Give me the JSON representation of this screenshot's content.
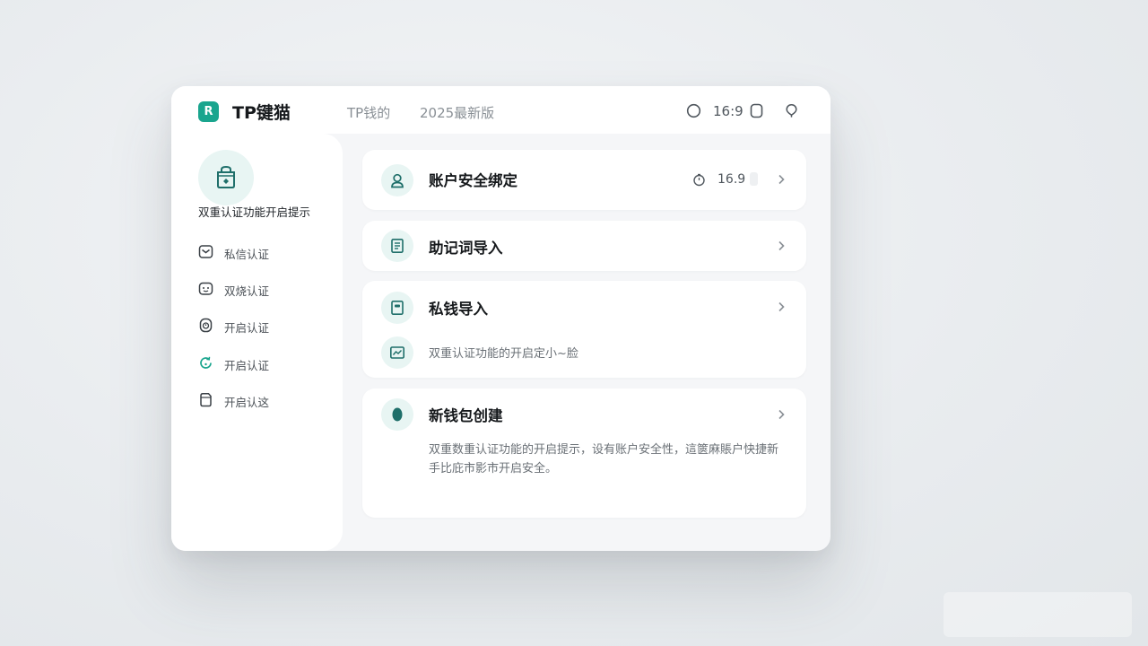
{
  "app": {
    "logo_letter": "R",
    "title": "TP键猫"
  },
  "header": {
    "tabs": [
      {
        "label": "TP钱的"
      },
      {
        "label": "2025最新版"
      }
    ],
    "ratio": "16:9",
    "icons": [
      "circle-icon",
      "rounded-square-icon",
      "location-pin-icon"
    ]
  },
  "sidebar": {
    "hero_icon": "lock-bag-icon",
    "title": "双重认证功能开启提示",
    "items": [
      {
        "label": "私信认证",
        "icon": "mail-icon"
      },
      {
        "label": "双烧认证",
        "icon": "robot-face-icon"
      },
      {
        "label": "开启认证",
        "icon": "clock-badge-icon"
      },
      {
        "label": "开启认证",
        "icon": "refresh-icon"
      },
      {
        "label": "开启认这",
        "icon": "document-icon"
      }
    ]
  },
  "cards": [
    {
      "title": "账户安全绑定",
      "icon": "user-icon",
      "meta": "16.9",
      "meta_icon": "timer-icon"
    },
    {
      "title": "助记词导入",
      "icon": "notes-icon"
    },
    {
      "title": "私钱导入",
      "icon": "wallet-icon",
      "sub_label": "双重认证功能的开启定小~脸",
      "sub_icon": "chart-icon"
    },
    {
      "title": "新钱包创建",
      "icon": "leaf-icon",
      "description": "双重数重认证功能的开启提示，设有账户安全性，這篋麻賬户快捷新手比庇市影市开启安全。"
    }
  ],
  "colors": {
    "accent": "#1aa58e",
    "accent_soft": "#e8f5f3",
    "icon_dark": "#1f6f6a",
    "background": "#eceff1"
  }
}
